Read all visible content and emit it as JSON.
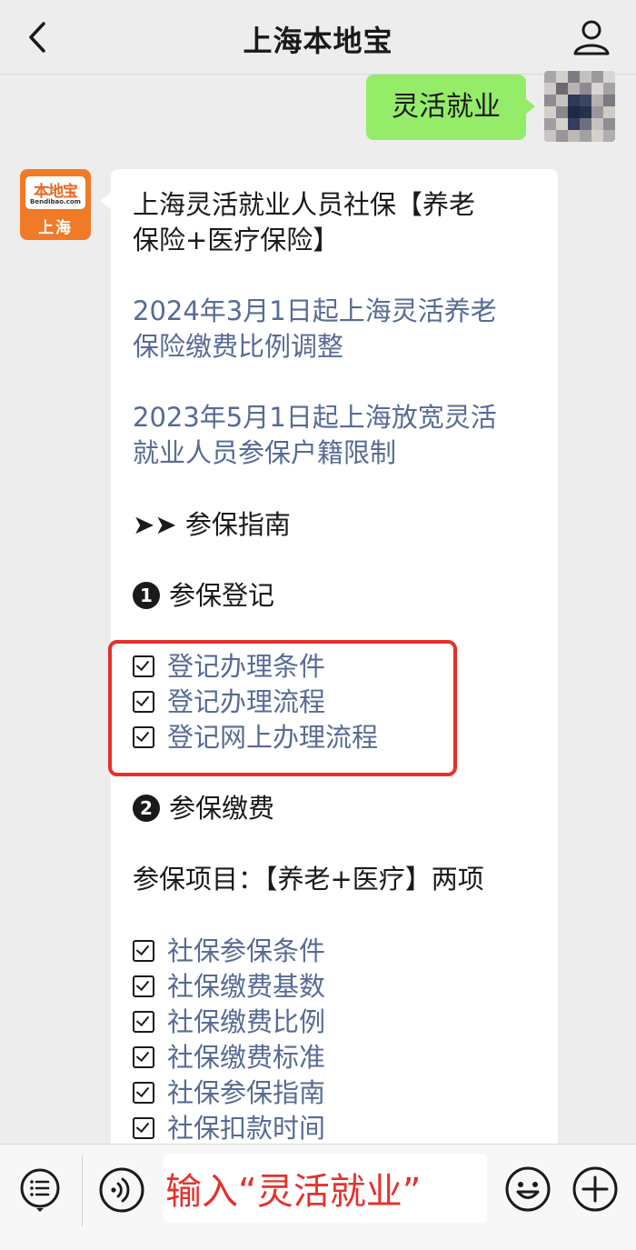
{
  "header": {
    "title": "上海本地宝",
    "back_icon": "chevron-left-icon",
    "profile_icon": "person-icon"
  },
  "sent_message": {
    "text": "灵活就业"
  },
  "bot": {
    "avatar_logo_text": "本地宝",
    "avatar_logo_url": "Bendibao.com",
    "avatar_city": "上海",
    "colors": {
      "brand": "#f07a26"
    }
  },
  "reply": {
    "title_line1": "上海灵活就业人员社保【养老",
    "title_line2": "保险+医疗保险】",
    "link1_line1": "2024年3月1日起上海灵活养老",
    "link1_line2": "保险缴费比例调整",
    "link2_line1": "2023年5月1日起上海放宽灵活",
    "link2_line2": "就业人员参保户籍限制",
    "guide_arrow": "➤➤",
    "guide_heading": "参保指南",
    "section1_number": "1",
    "section1_heading": "参保登记",
    "registration_links": [
      "登记办理条件",
      "登记办理流程",
      "登记网上办理流程"
    ],
    "section2_number": "2",
    "section2_heading": "参保缴费",
    "items_text": "参保项目：【养老+医疗】两项",
    "payment_links": [
      "社保参保条件",
      "社保缴费基数",
      "社保缴费比例",
      "社保缴费标准",
      "社保参保指南",
      "社保扣款时间"
    ]
  },
  "input_bar": {
    "value": "输入“灵活就业”",
    "menu_icon": "list-menu-icon",
    "voice_icon": "voice-icon",
    "emoji_icon": "emoji-icon",
    "plus_icon": "plus-icon"
  },
  "colors": {
    "link": "#576b95",
    "sent_bubble": "#95ec69",
    "highlight": "#e6312b"
  }
}
